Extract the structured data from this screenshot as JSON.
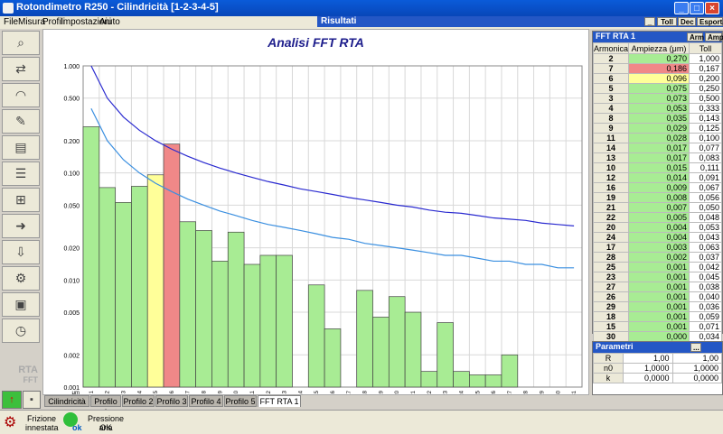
{
  "window": {
    "title": "Rotondimetro R250 - Cilindricità [1-2-3-4-5]",
    "minimize": "_",
    "maximize": "□",
    "close": "×"
  },
  "menu": [
    "File",
    "Misura",
    "Profili",
    "Impostazioni",
    "Aiuto"
  ],
  "results_panel": {
    "title": "Risultati",
    "btn_min": "_",
    "btn_toll": "Toll",
    "btn_dec": "Dec",
    "btn_export": "Esporta"
  },
  "chart_data": {
    "type": "bar",
    "title": "Analisi FFT RTA",
    "x_unit": "μm",
    "y_scale": "log",
    "ylim": [
      0.001,
      1.0
    ],
    "y_ticks": [
      "1.000",
      "0.500",
      "0.200",
      "0.100",
      "0.050",
      "0.020",
      "0.010",
      "0.005",
      "0.002",
      "0.001"
    ],
    "y_tick_values": [
      1.0,
      0.5,
      0.2,
      0.1,
      0.05,
      0.02,
      0.01,
      0.005,
      0.002,
      0.001
    ],
    "categories": [
      1,
      2,
      3,
      4,
      5,
      6,
      7,
      8,
      9,
      10,
      11,
      12,
      13,
      14,
      15,
      16,
      17,
      18,
      19,
      20,
      21,
      22,
      23,
      24,
      25,
      26,
      27,
      28,
      29,
      30,
      31
    ],
    "values": [
      0.27,
      0.073,
      0.053,
      0.075,
      0.096,
      0.186,
      0.035,
      0.029,
      0.015,
      0.028,
      0.014,
      0.017,
      0.017,
      0.0,
      0.009,
      0.0035,
      0.0,
      0.008,
      0.0045,
      0.007,
      0.005,
      0.0014,
      0.004,
      0.0014,
      0.0013,
      0.0013,
      0.002,
      0.0,
      0.0,
      0.0,
      0.0
    ],
    "bar_colors": {
      "ok": "#a8ec94",
      "warn": "#ffff99",
      "fail": "#f08888"
    },
    "status": [
      "ok",
      "ok",
      "ok",
      "ok",
      "warn",
      "fail",
      "ok",
      "ok",
      "ok",
      "ok",
      "ok",
      "ok",
      "ok",
      "ok",
      "ok",
      "ok",
      "ok",
      "ok",
      "ok",
      "ok",
      "ok",
      "ok",
      "ok",
      "ok",
      "ok",
      "ok",
      "ok",
      "ok",
      "ok",
      "ok",
      "ok"
    ],
    "series": [
      {
        "values": [
          1.0,
          0.5,
          0.333,
          0.25,
          0.2,
          0.167,
          0.143,
          0.125,
          0.111,
          0.1,
          0.091,
          0.083,
          0.077,
          0.071,
          0.067,
          0.063,
          0.059,
          0.056,
          0.053,
          0.05,
          0.048,
          0.045,
          0.043,
          0.042,
          0.04,
          0.038,
          0.037,
          0.036,
          0.034,
          0.033,
          0.032
        ],
        "color": "#2a2ad0"
      },
      {
        "values": [
          0.4,
          0.2,
          0.133,
          0.1,
          0.08,
          0.067,
          0.057,
          0.05,
          0.044,
          0.04,
          0.036,
          0.033,
          0.031,
          0.029,
          0.027,
          0.025,
          0.024,
          0.022,
          0.021,
          0.02,
          0.019,
          0.018,
          0.017,
          0.017,
          0.016,
          0.015,
          0.015,
          0.014,
          0.014,
          0.013,
          0.013
        ],
        "color": "#3a8fe0"
      }
    ]
  },
  "fft_table": {
    "title": "FFT RTA 1",
    "btn_arm": "Arm",
    "btn_amp": "Amp",
    "col_harmonic": "Armonica",
    "col_amplitude": "Ampiezza (μm)",
    "col_tol": "Toll",
    "rows": [
      {
        "h": "2",
        "a": "0,270",
        "t": "1,000",
        "s": "ok"
      },
      {
        "h": "7",
        "a": "0,186",
        "t": "0,167",
        "s": "fail"
      },
      {
        "h": "6",
        "a": "0,096",
        "t": "0,200",
        "s": "warn"
      },
      {
        "h": "5",
        "a": "0,075",
        "t": "0,250",
        "s": "ok"
      },
      {
        "h": "3",
        "a": "0,073",
        "t": "0,500",
        "s": "ok"
      },
      {
        "h": "4",
        "a": "0,053",
        "t": "0,333",
        "s": "ok"
      },
      {
        "h": "8",
        "a": "0,035",
        "t": "0,143",
        "s": "ok"
      },
      {
        "h": "9",
        "a": "0,029",
        "t": "0,125",
        "s": "ok"
      },
      {
        "h": "11",
        "a": "0,028",
        "t": "0,100",
        "s": "ok"
      },
      {
        "h": "14",
        "a": "0,017",
        "t": "0,077",
        "s": "ok"
      },
      {
        "h": "13",
        "a": "0,017",
        "t": "0,083",
        "s": "ok"
      },
      {
        "h": "10",
        "a": "0,015",
        "t": "0,111",
        "s": "ok"
      },
      {
        "h": "12",
        "a": "0,014",
        "t": "0,091",
        "s": "ok"
      },
      {
        "h": "16",
        "a": "0,009",
        "t": "0,067",
        "s": "ok"
      },
      {
        "h": "19",
        "a": "0,008",
        "t": "0,056",
        "s": "ok"
      },
      {
        "h": "21",
        "a": "0,007",
        "t": "0,050",
        "s": "ok"
      },
      {
        "h": "22",
        "a": "0,005",
        "t": "0,048",
        "s": "ok"
      },
      {
        "h": "20",
        "a": "0,004",
        "t": "0,053",
        "s": "ok"
      },
      {
        "h": "24",
        "a": "0,004",
        "t": "0,043",
        "s": "ok"
      },
      {
        "h": "17",
        "a": "0,003",
        "t": "0,063",
        "s": "ok"
      },
      {
        "h": "28",
        "a": "0,002",
        "t": "0,037",
        "s": "ok"
      },
      {
        "h": "25",
        "a": "0,001",
        "t": "0,042",
        "s": "ok"
      },
      {
        "h": "23",
        "a": "0,001",
        "t": "0,045",
        "s": "ok"
      },
      {
        "h": "27",
        "a": "0,001",
        "t": "0,038",
        "s": "ok"
      },
      {
        "h": "26",
        "a": "0,001",
        "t": "0,040",
        "s": "ok"
      },
      {
        "h": "29",
        "a": "0,001",
        "t": "0,036",
        "s": "ok"
      },
      {
        "h": "18",
        "a": "0,001",
        "t": "0,059",
        "s": "ok"
      },
      {
        "h": "15",
        "a": "0,001",
        "t": "0,071",
        "s": "ok"
      },
      {
        "h": "30",
        "a": "0,000",
        "t": "0,034",
        "s": "ok"
      }
    ]
  },
  "params": {
    "title": "Parametri",
    "btn": "...",
    "rows": [
      {
        "k": "R",
        "v1": "1,00",
        "v2": "1,00"
      },
      {
        "k": "n0",
        "v1": "1,0000",
        "v2": "1,0000"
      },
      {
        "k": "k",
        "v1": "0,0000",
        "v2": "0,0000"
      }
    ]
  },
  "tabs": [
    "Cilindricità",
    "Profilo 1",
    "Profilo 2",
    "Profilo 3",
    "Profilo 4",
    "Profilo 5",
    "FFT RTA 1"
  ],
  "active_tab": "FFT RTA 1",
  "rta_logo": "RTA",
  "rta_logo_sub": "FFT",
  "status": {
    "friction": "Frizione innestata",
    "air_pressure": "Pressione aria",
    "air_value": "OK",
    "ok_badge": "ok"
  },
  "toolbar_icons": [
    "zoom-icon",
    "profile-compare-icon",
    "roundness-icon",
    "eraser-icon",
    "print-icon",
    "report-icon",
    "measure-icon",
    "export-icon",
    "import-icon",
    "tools-icon",
    "save-icon",
    "clock-icon"
  ]
}
